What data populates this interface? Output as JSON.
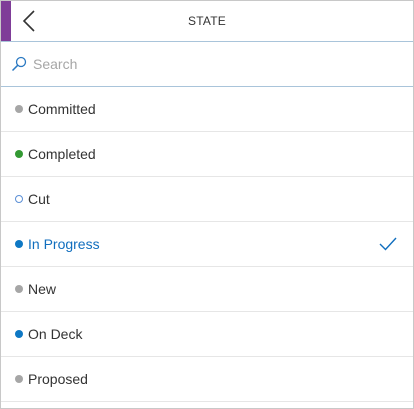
{
  "header": {
    "title": "STATE",
    "accent_color": "#7f3d98",
    "back_icon": "chevron-left-icon"
  },
  "search": {
    "placeholder": "Search",
    "value": "",
    "icon": "search-icon"
  },
  "states": [
    {
      "label": "Committed",
      "color": "#a6a6a6",
      "style": "filled",
      "selected": false
    },
    {
      "label": "Completed",
      "color": "#339933",
      "style": "filled",
      "selected": false
    },
    {
      "label": "Cut",
      "color": "#5b8fd6",
      "style": "hollow",
      "selected": false
    },
    {
      "label": "In Progress",
      "color": "#0e78c4",
      "style": "filled",
      "selected": true
    },
    {
      "label": "New",
      "color": "#a6a6a6",
      "style": "filled",
      "selected": false
    },
    {
      "label": "On Deck",
      "color": "#0e78c4",
      "style": "filled",
      "selected": false
    },
    {
      "label": "Proposed",
      "color": "#a6a6a6",
      "style": "filled",
      "selected": false
    }
  ],
  "selected_color": "#106ebe",
  "check_icon": "checkmark-icon"
}
